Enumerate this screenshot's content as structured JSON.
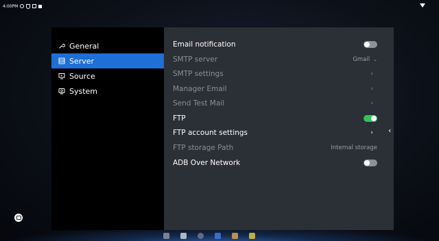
{
  "statusbar": {
    "time": "4:00PM",
    "icons": [
      "gear-icon",
      "shield-icon",
      "notification-icon",
      "square-icon",
      "wifi-icon"
    ]
  },
  "sidebar": {
    "items": [
      {
        "label": "General",
        "icon": "wrench-icon",
        "active": false
      },
      {
        "label": "Server",
        "icon": "server-icon",
        "active": true
      },
      {
        "label": "Source",
        "icon": "source-icon",
        "active": false
      },
      {
        "label": "System",
        "icon": "system-icon",
        "active": false
      }
    ]
  },
  "settings": {
    "email_notification": {
      "label": "Email notification",
      "toggle": "off"
    },
    "smtp_server": {
      "label": "SMTP server",
      "value": "Gmail"
    },
    "smtp_settings": {
      "label": "SMTP settings"
    },
    "manager_email": {
      "label": "Manager Email"
    },
    "send_test_mail": {
      "label": "Send Test Mail"
    },
    "ftp": {
      "label": "FTP",
      "toggle": "on"
    },
    "ftp_account_settings": {
      "label": "FTP account settings"
    },
    "ftp_storage_path": {
      "label": "FTP storage Path",
      "value": "Internal storage"
    },
    "adb_over_network": {
      "label": "ADB Over Network",
      "toggle": "off"
    }
  },
  "colors": {
    "accent": "#1e6fd6",
    "toggle_on": "#2fc35a",
    "toggle_off": "#8d9198",
    "panel": "#2b2f36",
    "sidebar": "#000000"
  },
  "dock": {
    "icons": [
      "keyboard-icon",
      "files-icon",
      "settings-icon",
      "play-store-icon",
      "calendar-icon",
      "app-icon"
    ]
  }
}
